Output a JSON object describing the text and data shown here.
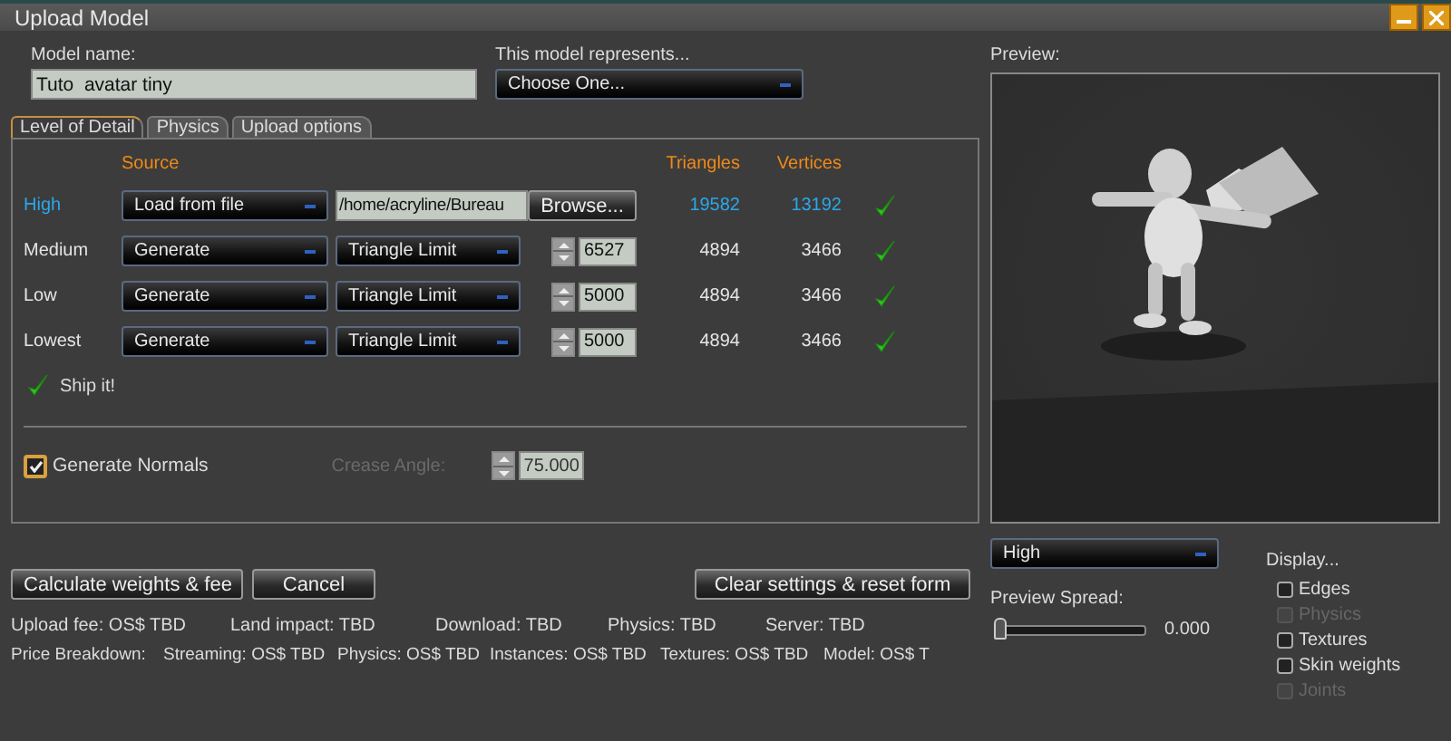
{
  "window": {
    "title": "Upload Model"
  },
  "model_name": {
    "label": "Model name:",
    "value": "Tuto  avatar tiny"
  },
  "represents": {
    "label": "This model represents...",
    "value": "Choose One..."
  },
  "tabs": [
    {
      "label": "Level of Detail",
      "selected": true
    },
    {
      "label": "Physics",
      "selected": false
    },
    {
      "label": "Upload options",
      "selected": false
    }
  ],
  "lod": {
    "columns": {
      "source": "Source",
      "triangles": "Triangles",
      "vertices": "Vertices"
    },
    "rows": [
      {
        "label": "High",
        "kind": "file",
        "source": "Load from file",
        "path": "/home/acryline/Bureau",
        "button": "Browse...",
        "triangles": "19582",
        "vertices": "13192",
        "ok": true
      },
      {
        "label": "Medium",
        "kind": "generate",
        "source": "Generate",
        "method": "Triangle Limit",
        "limit": "6527",
        "triangles": "4894",
        "vertices": "3466",
        "ok": true
      },
      {
        "label": "Low",
        "kind": "generate",
        "source": "Generate",
        "method": "Triangle Limit",
        "limit": "5000",
        "triangles": "4894",
        "vertices": "3466",
        "ok": true
      },
      {
        "label": "Lowest",
        "kind": "generate",
        "source": "Generate",
        "method": "Triangle Limit",
        "limit": "5000",
        "triangles": "4894",
        "vertices": "3466",
        "ok": true
      }
    ],
    "ship_it": {
      "text": "Ship it!",
      "ok": true
    }
  },
  "generate_normals": {
    "label": "Generate Normals",
    "checked": true
  },
  "crease_angle": {
    "label": "Crease Angle:",
    "value": "75.000",
    "disabled": true
  },
  "buttons": {
    "calculate": "Calculate weights & fee",
    "cancel": "Cancel",
    "clear": "Clear settings & reset form"
  },
  "fees": [
    "Upload fee: OS$ TBD",
    "Land impact: TBD",
    "Download: TBD",
    "Physics: TBD",
    "Server: TBD"
  ],
  "price_breakdown": [
    "Price Breakdown:",
    "Streaming: OS$ TBD",
    "Physics: OS$ TBD",
    "Instances: OS$ TBD",
    "Textures: OS$ TBD",
    "Model: OS$ T"
  ],
  "preview": {
    "label": "Preview:",
    "lod": "High",
    "spread": {
      "label": "Preview Spread:",
      "level": 0,
      "reading": "0.000"
    },
    "display_label": "Display...",
    "options": [
      {
        "label": "Edges",
        "checked": false,
        "disabled": false
      },
      {
        "label": "Physics",
        "checked": false,
        "disabled": true
      },
      {
        "label": "Textures",
        "checked": false,
        "disabled": false
      },
      {
        "label": "Skin weights",
        "checked": false,
        "disabled": false
      },
      {
        "label": "Joints",
        "checked": false,
        "disabled": true
      }
    ]
  }
}
